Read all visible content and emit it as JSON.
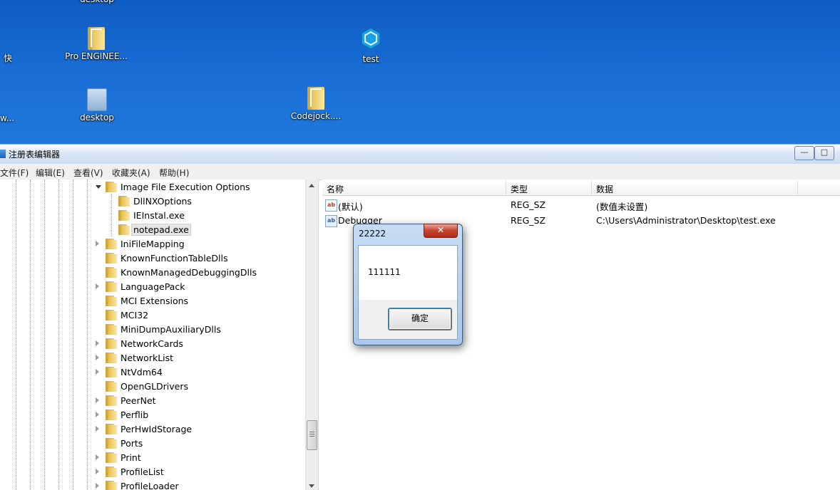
{
  "desktop": {
    "icons": [
      {
        "label": "desktop",
        "kind": "folder"
      },
      {
        "label": "Pro ENGINEE...",
        "kind": "folder"
      },
      {
        "label": "desktop",
        "kind": "document"
      },
      {
        "label": "test",
        "kind": "hexagon-app"
      },
      {
        "label": "Codejock....",
        "kind": "folder"
      }
    ],
    "edge_labels": [
      "快",
      "w..."
    ]
  },
  "window": {
    "title": "注册表编辑器",
    "buttons": {
      "minimize": "—",
      "maximize": "□"
    }
  },
  "menu": [
    "文件(F)",
    "编辑(E)",
    "查看(V)",
    "收藏夹(A)",
    "帮助(H)"
  ],
  "tree": {
    "items": [
      {
        "label": "Image File Execution Options",
        "expanded": true,
        "level": 1
      },
      {
        "label": "DllNXOptions",
        "level": 2
      },
      {
        "label": "IEInstal.exe",
        "level": 2
      },
      {
        "label": "notepad.exe",
        "level": 2,
        "selected": true
      },
      {
        "label": "IniFileMapping",
        "expandable": true,
        "level": 1
      },
      {
        "label": "KnownFunctionTableDlls",
        "level": 1
      },
      {
        "label": "KnownManagedDebuggingDlls",
        "level": 1
      },
      {
        "label": "LanguagePack",
        "expandable": true,
        "level": 1
      },
      {
        "label": "MCI Extensions",
        "level": 1
      },
      {
        "label": "MCI32",
        "level": 1
      },
      {
        "label": "MiniDumpAuxiliaryDlls",
        "level": 1
      },
      {
        "label": "NetworkCards",
        "expandable": true,
        "level": 1
      },
      {
        "label": "NetworkList",
        "expandable": true,
        "level": 1
      },
      {
        "label": "NtVdm64",
        "expandable": true,
        "level": 1
      },
      {
        "label": "OpenGLDrivers",
        "level": 1
      },
      {
        "label": "PeerNet",
        "expandable": true,
        "level": 1
      },
      {
        "label": "Perflib",
        "expandable": true,
        "level": 1
      },
      {
        "label": "PerHwIdStorage",
        "expandable": true,
        "level": 1
      },
      {
        "label": "Ports",
        "level": 1
      },
      {
        "label": "Print",
        "expandable": true,
        "level": 1
      },
      {
        "label": "ProfileList",
        "expandable": true,
        "level": 1
      },
      {
        "label": "ProfileLoader",
        "expandable": true,
        "level": 1
      }
    ]
  },
  "values_list": {
    "columns": [
      "名称",
      "类型",
      "数据"
    ],
    "rows": [
      {
        "name": "(默认)",
        "type": "REG_SZ",
        "data": "(数值未设置)"
      },
      {
        "name": "Debugger",
        "type": "REG_SZ",
        "data": "C:\\Users\\Administrator\\Desktop\\test.exe"
      }
    ]
  },
  "message_box": {
    "title": "22222",
    "close": "✕",
    "message": "111111",
    "ok_label": "确定"
  }
}
